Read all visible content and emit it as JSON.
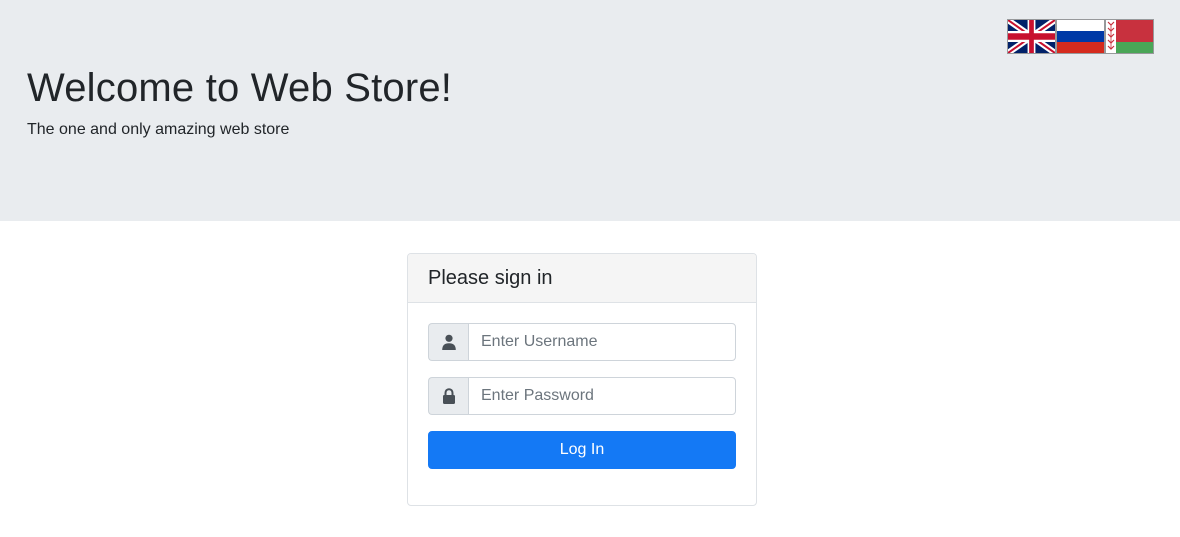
{
  "header": {
    "title": "Welcome to Web Store!",
    "subtitle": "The one and only amazing web store",
    "background": "#e9ecef"
  },
  "languages": [
    {
      "name": "uk-flag-icon"
    },
    {
      "name": "russia-flag-icon"
    },
    {
      "name": "belarus-flag-icon"
    }
  ],
  "login": {
    "heading": "Please sign in",
    "username": {
      "value": "",
      "placeholder": "Enter Username",
      "icon": "user-icon"
    },
    "password": {
      "value": "",
      "placeholder": "Enter Password",
      "icon": "lock-icon"
    },
    "submit_label": "Log In"
  },
  "colors": {
    "primary": "#1479f5",
    "card_header_bg": "#f5f5f5",
    "border": "#dee2e6"
  }
}
